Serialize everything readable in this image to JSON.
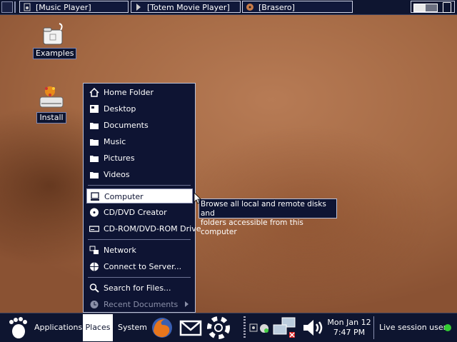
{
  "top_panel": {
    "tasks": [
      {
        "label": "[Music Player]",
        "icon": "music-player-icon"
      },
      {
        "label": "[Totem Movie Player]",
        "icon": "totem-icon"
      },
      {
        "label": "[Brasero]",
        "icon": "brasero-icon"
      }
    ]
  },
  "desktop": {
    "icons": [
      {
        "label": "Examples",
        "icon": "examples-folder-icon"
      },
      {
        "label": "Install",
        "icon": "install-icon"
      }
    ]
  },
  "places_menu": {
    "items": [
      {
        "label": "Home Folder",
        "icon": "home-icon"
      },
      {
        "label": "Desktop",
        "icon": "desktop-icon"
      },
      {
        "label": "Documents",
        "icon": "folder-icon"
      },
      {
        "label": "Music",
        "icon": "folder-icon"
      },
      {
        "label": "Pictures",
        "icon": "folder-icon"
      },
      {
        "label": "Videos",
        "icon": "folder-icon"
      },
      {
        "label": "Computer",
        "icon": "computer-icon",
        "selected": true
      },
      {
        "label": "CD/DVD Creator",
        "icon": "cd-icon"
      },
      {
        "label": "CD-ROM/DVD-ROM Drive",
        "icon": "drive-icon"
      },
      {
        "label": "Network",
        "icon": "network-icon"
      },
      {
        "label": "Connect to Server...",
        "icon": "server-icon"
      },
      {
        "label": "Search for Files...",
        "icon": "search-icon"
      },
      {
        "label": "Recent Documents",
        "icon": "clock-icon",
        "disabled": true
      }
    ]
  },
  "tooltip": {
    "line1": "Browse all local and remote disks and",
    "line2": "folders accessible from this computer"
  },
  "bottom_panel": {
    "applications_label": "Applications",
    "places_label": "Places",
    "system_label": "System",
    "clock_date": "Mon Jan 12",
    "clock_time": "7:47 PM",
    "session_label": "Live session user"
  },
  "colors": {
    "panel_bg": "#0e1530",
    "menu_bg": "#0e1433",
    "session_green": "#33cc33"
  }
}
